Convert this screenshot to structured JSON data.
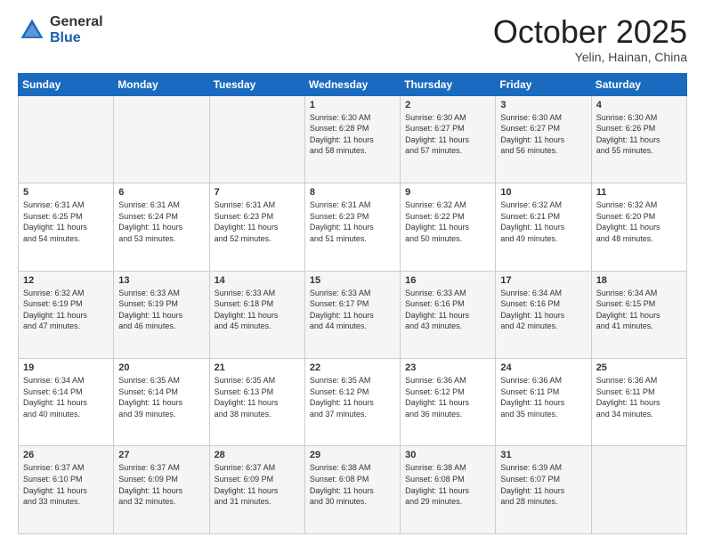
{
  "header": {
    "logo_general": "General",
    "logo_blue": "Blue",
    "month": "October 2025",
    "location": "Yelin, Hainan, China"
  },
  "weekdays": [
    "Sunday",
    "Monday",
    "Tuesday",
    "Wednesday",
    "Thursday",
    "Friday",
    "Saturday"
  ],
  "weeks": [
    [
      {
        "day": "",
        "info": ""
      },
      {
        "day": "",
        "info": ""
      },
      {
        "day": "",
        "info": ""
      },
      {
        "day": "1",
        "info": "Sunrise: 6:30 AM\nSunset: 6:28 PM\nDaylight: 11 hours\nand 58 minutes."
      },
      {
        "day": "2",
        "info": "Sunrise: 6:30 AM\nSunset: 6:27 PM\nDaylight: 11 hours\nand 57 minutes."
      },
      {
        "day": "3",
        "info": "Sunrise: 6:30 AM\nSunset: 6:27 PM\nDaylight: 11 hours\nand 56 minutes."
      },
      {
        "day": "4",
        "info": "Sunrise: 6:30 AM\nSunset: 6:26 PM\nDaylight: 11 hours\nand 55 minutes."
      }
    ],
    [
      {
        "day": "5",
        "info": "Sunrise: 6:31 AM\nSunset: 6:25 PM\nDaylight: 11 hours\nand 54 minutes."
      },
      {
        "day": "6",
        "info": "Sunrise: 6:31 AM\nSunset: 6:24 PM\nDaylight: 11 hours\nand 53 minutes."
      },
      {
        "day": "7",
        "info": "Sunrise: 6:31 AM\nSunset: 6:23 PM\nDaylight: 11 hours\nand 52 minutes."
      },
      {
        "day": "8",
        "info": "Sunrise: 6:31 AM\nSunset: 6:23 PM\nDaylight: 11 hours\nand 51 minutes."
      },
      {
        "day": "9",
        "info": "Sunrise: 6:32 AM\nSunset: 6:22 PM\nDaylight: 11 hours\nand 50 minutes."
      },
      {
        "day": "10",
        "info": "Sunrise: 6:32 AM\nSunset: 6:21 PM\nDaylight: 11 hours\nand 49 minutes."
      },
      {
        "day": "11",
        "info": "Sunrise: 6:32 AM\nSunset: 6:20 PM\nDaylight: 11 hours\nand 48 minutes."
      }
    ],
    [
      {
        "day": "12",
        "info": "Sunrise: 6:32 AM\nSunset: 6:19 PM\nDaylight: 11 hours\nand 47 minutes."
      },
      {
        "day": "13",
        "info": "Sunrise: 6:33 AM\nSunset: 6:19 PM\nDaylight: 11 hours\nand 46 minutes."
      },
      {
        "day": "14",
        "info": "Sunrise: 6:33 AM\nSunset: 6:18 PM\nDaylight: 11 hours\nand 45 minutes."
      },
      {
        "day": "15",
        "info": "Sunrise: 6:33 AM\nSunset: 6:17 PM\nDaylight: 11 hours\nand 44 minutes."
      },
      {
        "day": "16",
        "info": "Sunrise: 6:33 AM\nSunset: 6:16 PM\nDaylight: 11 hours\nand 43 minutes."
      },
      {
        "day": "17",
        "info": "Sunrise: 6:34 AM\nSunset: 6:16 PM\nDaylight: 11 hours\nand 42 minutes."
      },
      {
        "day": "18",
        "info": "Sunrise: 6:34 AM\nSunset: 6:15 PM\nDaylight: 11 hours\nand 41 minutes."
      }
    ],
    [
      {
        "day": "19",
        "info": "Sunrise: 6:34 AM\nSunset: 6:14 PM\nDaylight: 11 hours\nand 40 minutes."
      },
      {
        "day": "20",
        "info": "Sunrise: 6:35 AM\nSunset: 6:14 PM\nDaylight: 11 hours\nand 39 minutes."
      },
      {
        "day": "21",
        "info": "Sunrise: 6:35 AM\nSunset: 6:13 PM\nDaylight: 11 hours\nand 38 minutes."
      },
      {
        "day": "22",
        "info": "Sunrise: 6:35 AM\nSunset: 6:12 PM\nDaylight: 11 hours\nand 37 minutes."
      },
      {
        "day": "23",
        "info": "Sunrise: 6:36 AM\nSunset: 6:12 PM\nDaylight: 11 hours\nand 36 minutes."
      },
      {
        "day": "24",
        "info": "Sunrise: 6:36 AM\nSunset: 6:11 PM\nDaylight: 11 hours\nand 35 minutes."
      },
      {
        "day": "25",
        "info": "Sunrise: 6:36 AM\nSunset: 6:11 PM\nDaylight: 11 hours\nand 34 minutes."
      }
    ],
    [
      {
        "day": "26",
        "info": "Sunrise: 6:37 AM\nSunset: 6:10 PM\nDaylight: 11 hours\nand 33 minutes."
      },
      {
        "day": "27",
        "info": "Sunrise: 6:37 AM\nSunset: 6:09 PM\nDaylight: 11 hours\nand 32 minutes."
      },
      {
        "day": "28",
        "info": "Sunrise: 6:37 AM\nSunset: 6:09 PM\nDaylight: 11 hours\nand 31 minutes."
      },
      {
        "day": "29",
        "info": "Sunrise: 6:38 AM\nSunset: 6:08 PM\nDaylight: 11 hours\nand 30 minutes."
      },
      {
        "day": "30",
        "info": "Sunrise: 6:38 AM\nSunset: 6:08 PM\nDaylight: 11 hours\nand 29 minutes."
      },
      {
        "day": "31",
        "info": "Sunrise: 6:39 AM\nSunset: 6:07 PM\nDaylight: 11 hours\nand 28 minutes."
      },
      {
        "day": "",
        "info": ""
      }
    ]
  ]
}
